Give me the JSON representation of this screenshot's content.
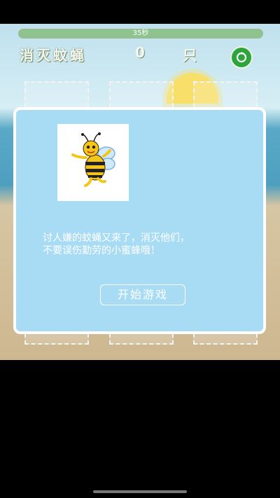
{
  "game": {
    "timer": "35秒",
    "timer_fraction": 1.0,
    "title": "消灭蚊蝇",
    "count": "0",
    "unit": "只",
    "refresh_icon": "refresh-icon"
  },
  "dialog": {
    "image": "bee-illustration",
    "message_line1": "讨人嫌的蚊蝇又来了，消灭他们，",
    "message_line2": "不要误伤勤劳的小蜜蜂哦！",
    "start_button": "开始游戏"
  },
  "colors": {
    "dialog_bg": "#a8dcf4",
    "refresh_green": "#2ea43c",
    "bee_yellow": "#f5c518"
  }
}
